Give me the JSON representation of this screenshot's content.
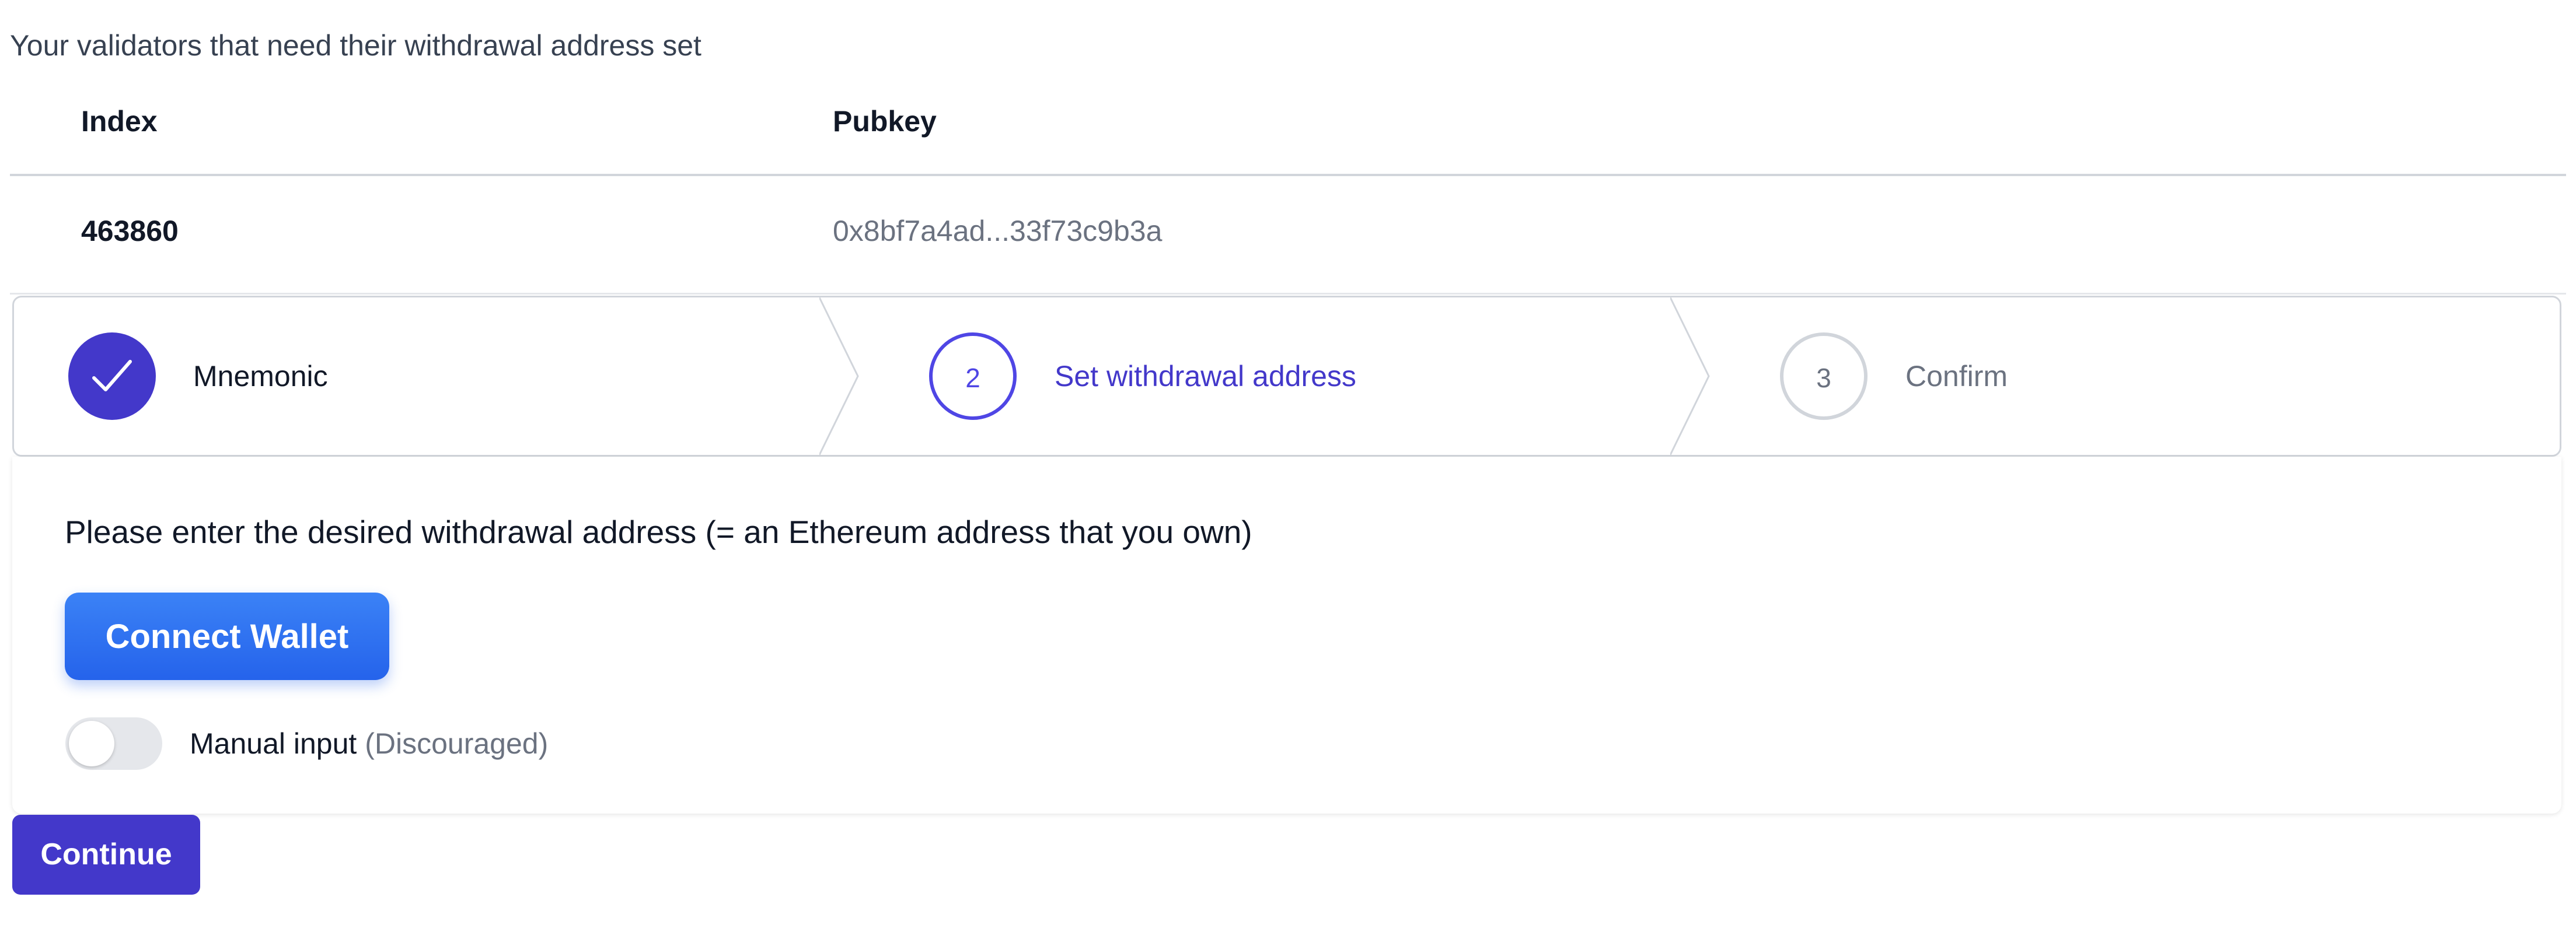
{
  "intro_text": "Your validators that need their withdrawal address set",
  "table": {
    "columns": [
      "Index",
      "Pubkey"
    ],
    "rows": [
      {
        "index": "463860",
        "pubkey": "0x8bf7a4ad...33f73c9b3a"
      }
    ]
  },
  "steps": [
    {
      "number": "",
      "label": "Mnemonic",
      "state": "complete",
      "icon": "check-icon"
    },
    {
      "number": "2",
      "label": "Set withdrawal address",
      "state": "current"
    },
    {
      "number": "3",
      "label": "Confirm",
      "state": "upcoming"
    }
  ],
  "panel": {
    "instruction": "Please enter the desired withdrawal address (= an Ethereum address that you own)",
    "connect_wallet_label": "Connect Wallet",
    "manual_input_label": "Manual input",
    "manual_input_note": "(Discouraged)",
    "manual_input_enabled": false
  },
  "continue_label": "Continue",
  "colors": {
    "primary": "#4338ca",
    "wallet_button": "#2563eb",
    "border": "#d1d5db",
    "muted_text": "#6b7280"
  }
}
